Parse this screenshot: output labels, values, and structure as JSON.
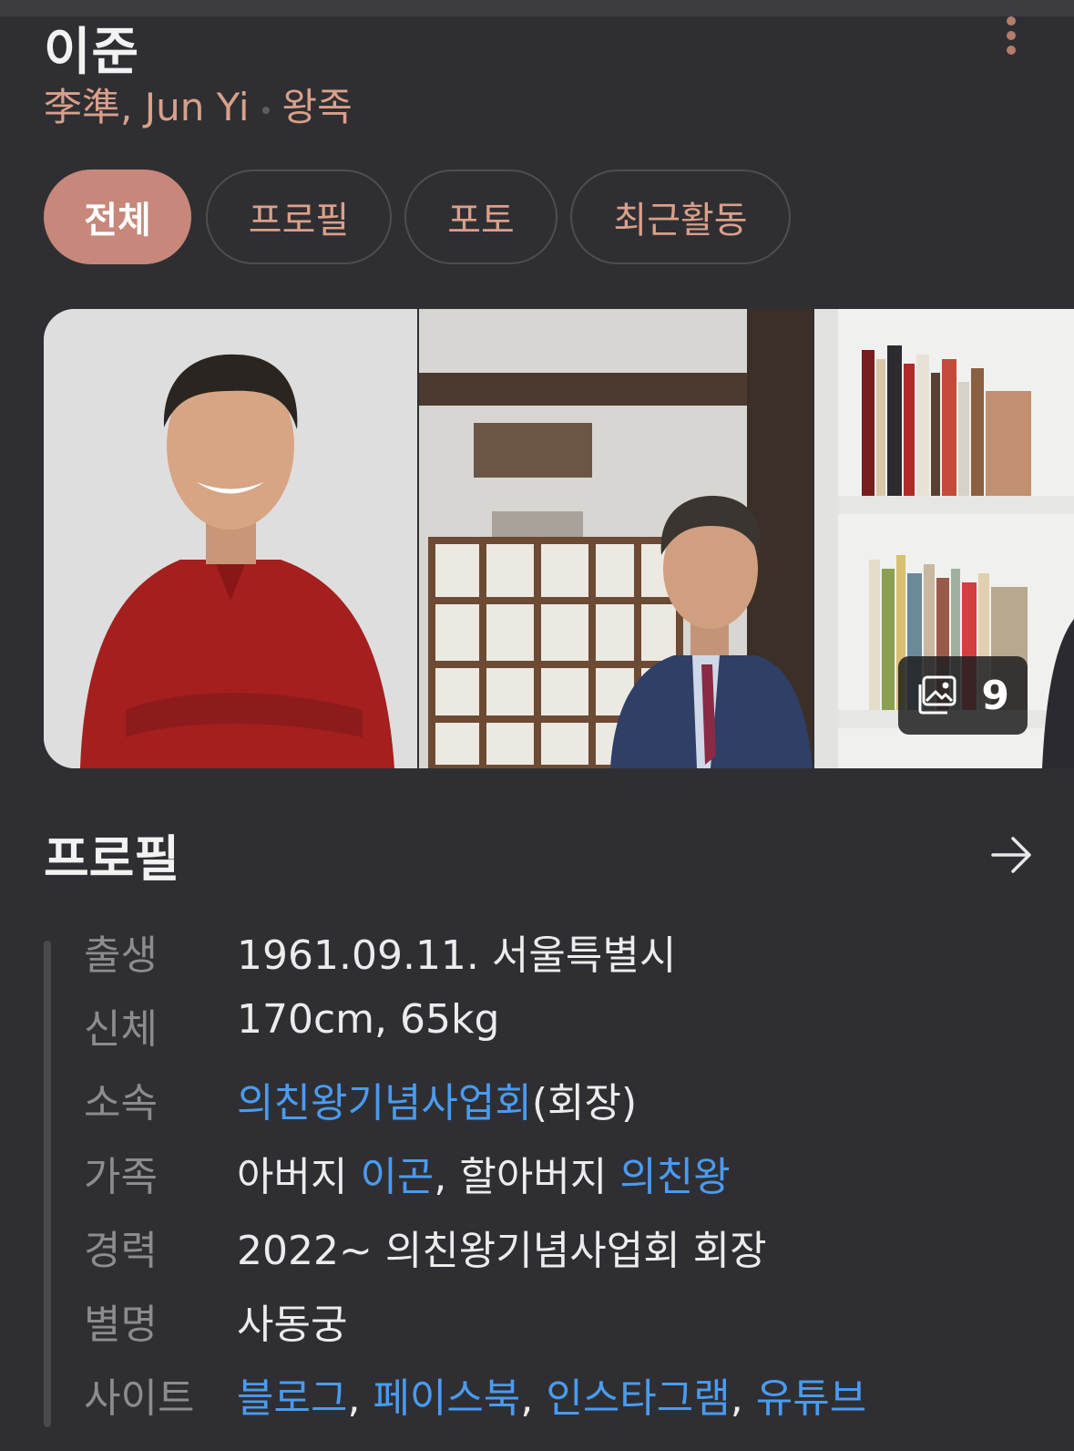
{
  "header": {
    "name": "이준",
    "subtitle_name": "李準, Jun Yi",
    "subtitle_category": "왕족"
  },
  "tabs": [
    {
      "label": "전체",
      "active": true
    },
    {
      "label": "프로필",
      "active": false
    },
    {
      "label": "포토",
      "active": false
    },
    {
      "label": "최근활동",
      "active": false
    }
  ],
  "gallery": {
    "photo_count": "9"
  },
  "profile": {
    "title": "프로필",
    "rows": {
      "birth": {
        "label": "출생",
        "value": "1961.09.11. 서울특별시"
      },
      "body": {
        "label": "신체",
        "value": "170cm, 65kg"
      },
      "affiliation": {
        "label": "소속",
        "link": "의친왕기념사업회",
        "suffix": "(회장)"
      },
      "family": {
        "label": "가족",
        "text1": "아버지 ",
        "link1": "이곤",
        "text2": ", 할아버지 ",
        "link2": "의친왕"
      },
      "career": {
        "label": "경력",
        "value": "2022~ 의친왕기념사업회 회장"
      },
      "alias": {
        "label": "별명",
        "value": "사동궁"
      },
      "sites": {
        "label": "사이트",
        "links": [
          "블로그",
          "페이스북",
          "인스타그램",
          "유튜브"
        ],
        "separator": ", "
      }
    }
  },
  "colors": {
    "background": "#2f2f33",
    "accent": "#c7877a",
    "subtitle": "#d9a08a",
    "link": "#4a9bf0"
  }
}
